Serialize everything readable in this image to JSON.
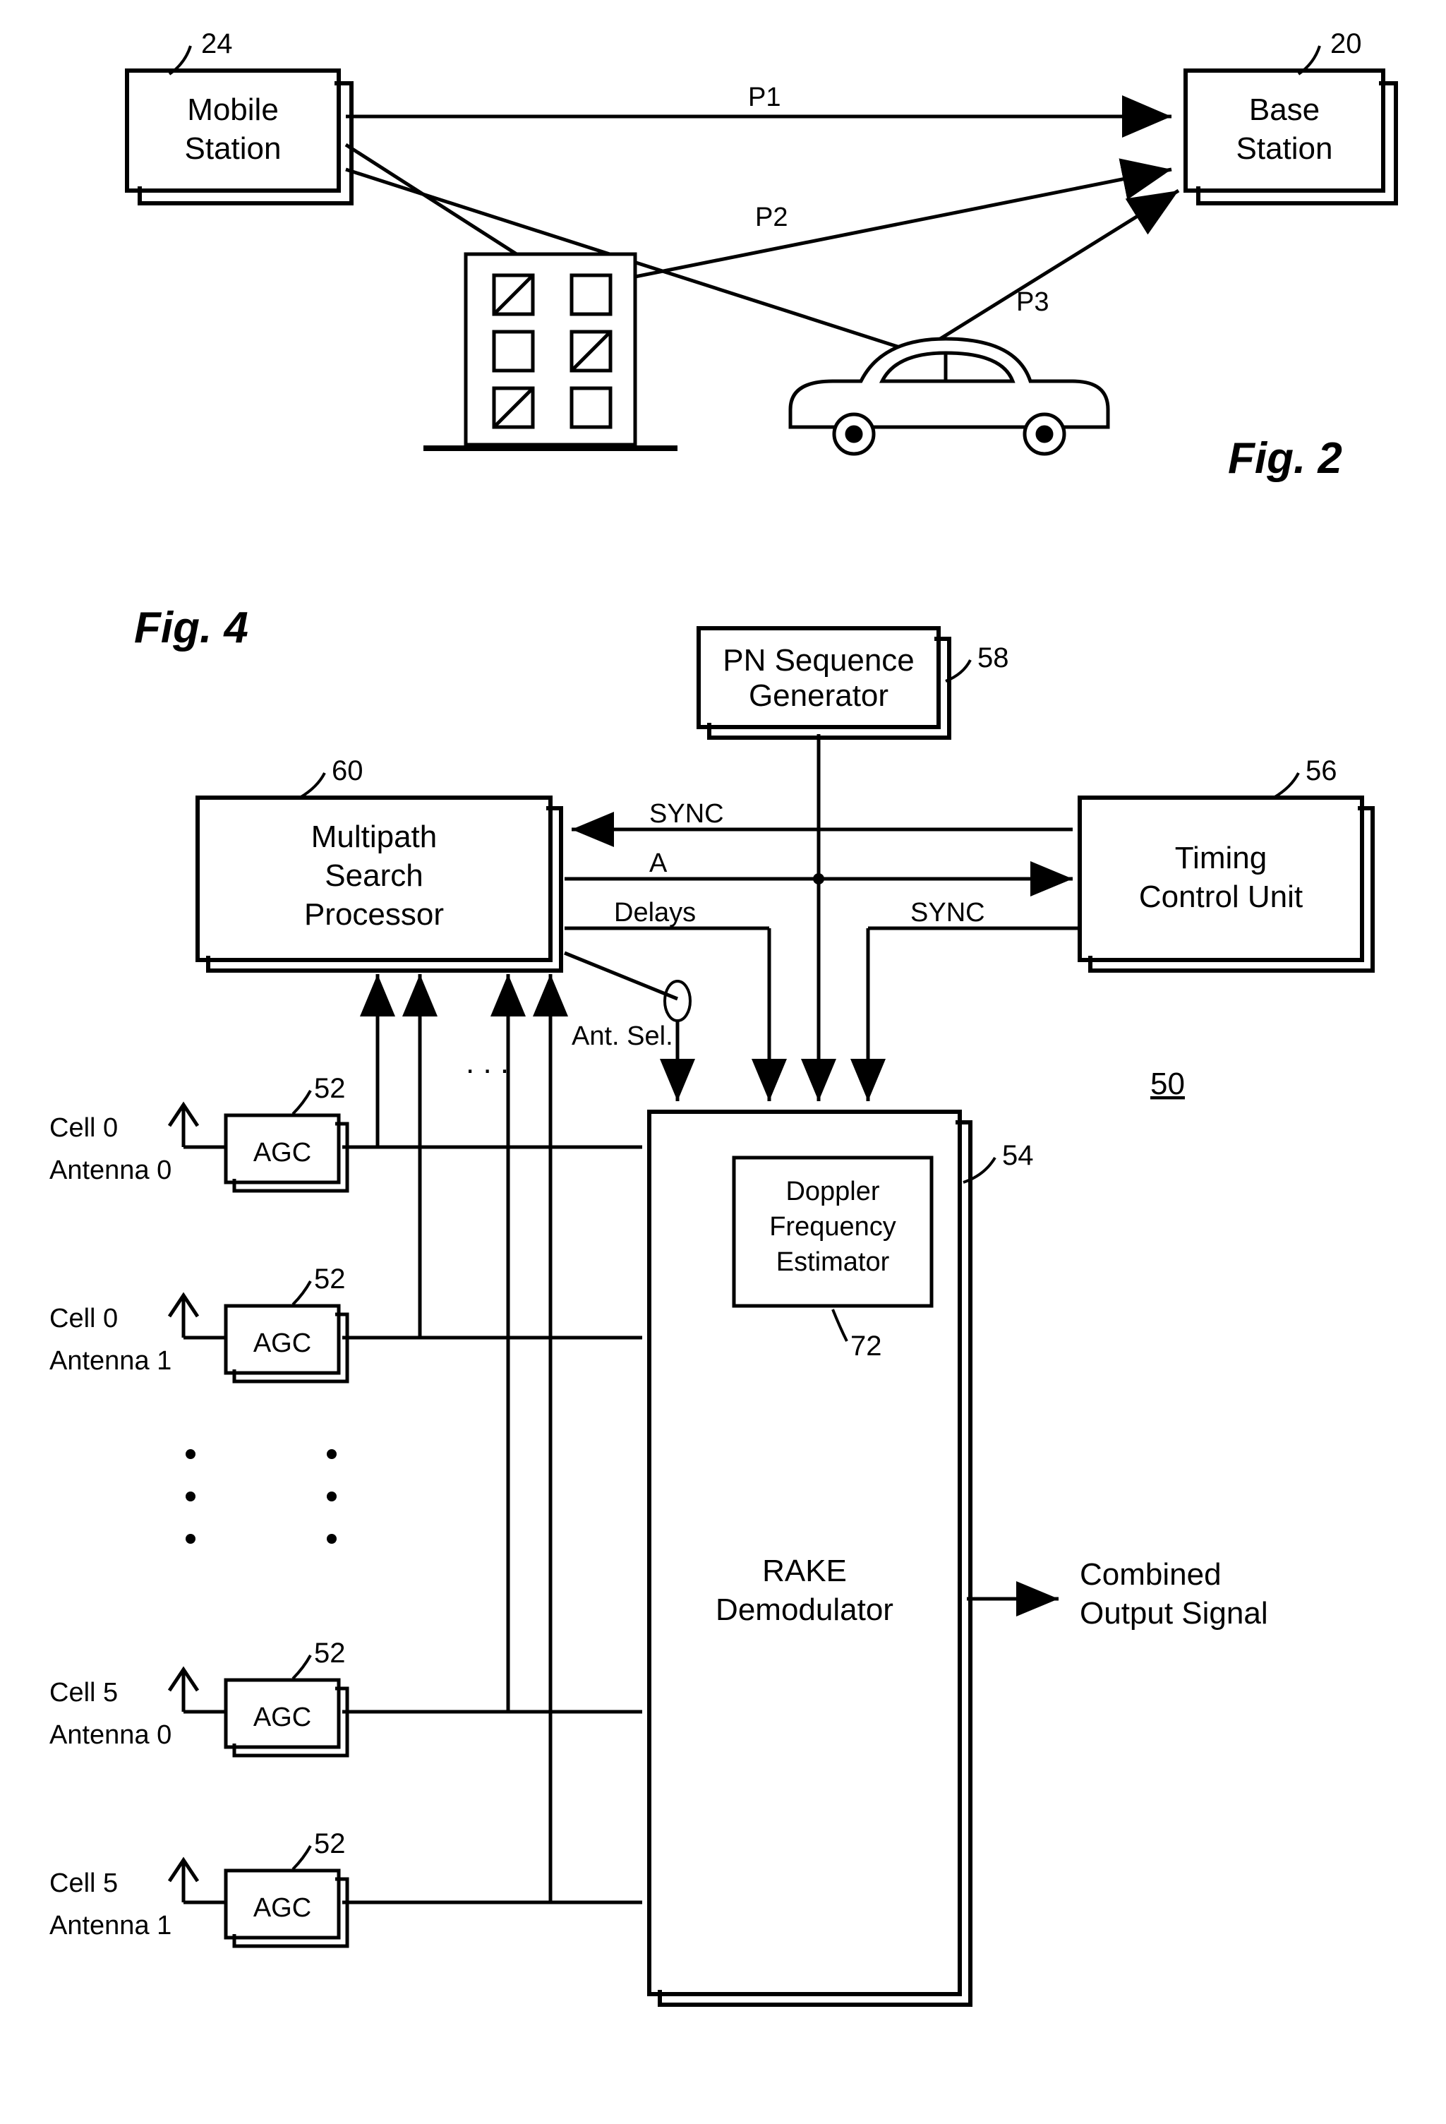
{
  "fig2": {
    "title": "Fig. 2",
    "mobile": "Mobile\nStation",
    "base": "Base\nStation",
    "ref_mobile": "24",
    "ref_base": "20",
    "p1": "P1",
    "p2": "P2",
    "p3": "P3"
  },
  "fig4": {
    "title": "Fig. 4",
    "pn": "PN Sequence\nGenerator",
    "ref_pn": "58",
    "msp": "Multipath\nSearch\nProcessor",
    "ref_msp": "60",
    "tcu": "Timing\nControl Unit",
    "ref_tcu": "56",
    "sync": "SYNC",
    "a": "A",
    "delays": "Delays",
    "antsel": "Ant. Sel.",
    "agc": "AGC",
    "ref_agc": "52",
    "rake": "RAKE\nDemodulator",
    "ref_rake": "54",
    "dfe": "Doppler\nFrequency\nEstimator",
    "ref_dfe": "72",
    "cos": "Combined\nOutput Signal",
    "ref_system": "50",
    "ant00c": "Cell 0",
    "ant00a": "Antenna 0",
    "ant01c": "Cell 0",
    "ant01a": "Antenna 1",
    "ant50c": "Cell 5",
    "ant50a": "Antenna 0",
    "ant51c": "Cell 5",
    "ant51a": "Antenna 1",
    "dots": ". . ."
  }
}
